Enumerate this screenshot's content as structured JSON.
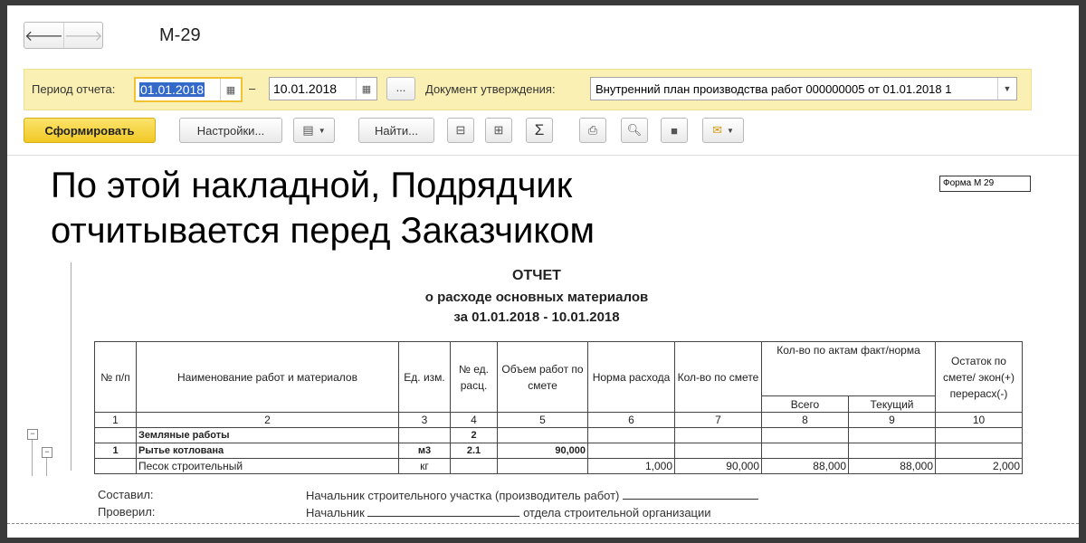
{
  "window": {
    "title": "М-29"
  },
  "nav": {
    "back": "🡐",
    "forward": "🡒"
  },
  "filter": {
    "period_label": "Период отчета:",
    "date_from": "01.01.2018",
    "dash": "–",
    "date_to": "10.01.2018",
    "dots": "...",
    "doc_label": "Документ утверждения:",
    "doc_value": "Внутренний план производства работ 000000005 от 01.01.2018 1"
  },
  "toolbar": {
    "generate": "Сформировать",
    "settings": "Настройки...",
    "find": "Найти...",
    "sigma": "Σ"
  },
  "overlay": {
    "line1": "По этой накладной, Подрядчик",
    "line2": "отчитывается перед Заказчиком"
  },
  "report": {
    "form_label": "Форма М 29",
    "title": "ОТЧЕТ",
    "subtitle": "о расходе основных материалов",
    "period": "за 01.01.2018 - 10.01.2018",
    "headers": {
      "num": "№ п/п",
      "name": "Наименование работ и материалов",
      "unit": "Ед. изм.",
      "norm_num": "№ ед. расц.",
      "volume": "Объем работ по смете",
      "rate": "Норма расхода",
      "qty_est": "Кол-во по смете",
      "acts": "Кол-во по актам факт/норма",
      "total": "Всего",
      "current": "Текущий",
      "remainder": "Остаток по смете/ экон(+) перерасх(-)"
    },
    "col_numbers": [
      "1",
      "2",
      "3",
      "4",
      "5",
      "6",
      "7",
      "8",
      "9",
      "10"
    ],
    "rows": [
      [
        "",
        "Земляные работы",
        "",
        "2",
        "",
        "",
        "",
        "",
        "",
        ""
      ],
      [
        "1",
        "Рытье котлована",
        "м3",
        "2.1",
        "90,000",
        "",
        "",
        "",
        "",
        ""
      ],
      [
        "",
        "Песок строительный",
        "кг",
        "",
        "",
        "1,000",
        "90,000",
        "88,000",
        "88,000",
        "2,000"
      ]
    ],
    "signatures": {
      "composed": "Составил:",
      "composed_role": "Начальник строительного участка (производитель работ)",
      "checked": "Проверил:",
      "checked_role1": "Начальник",
      "checked_role2": "отдела строительной организации"
    }
  }
}
